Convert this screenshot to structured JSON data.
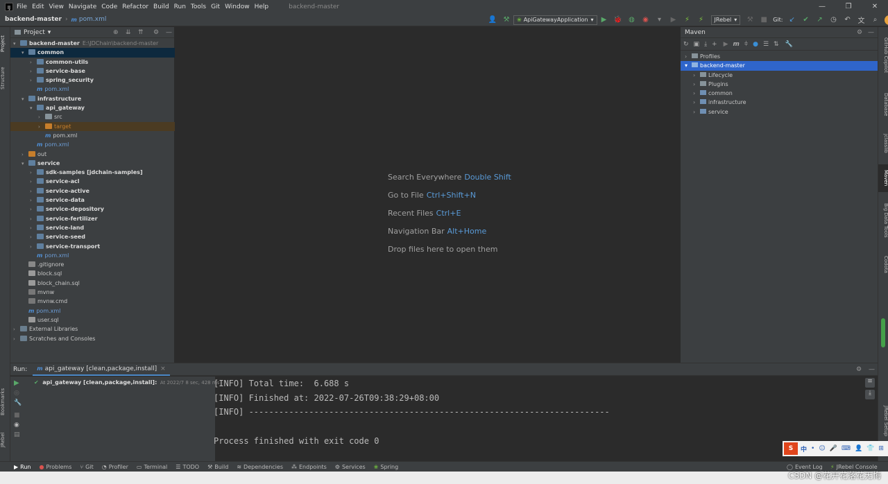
{
  "menubar": {
    "logo": "IJ",
    "items": [
      "File",
      "Edit",
      "View",
      "Navigate",
      "Code",
      "Refactor",
      "Build",
      "Run",
      "Tools",
      "Git",
      "Window",
      "Help"
    ],
    "window_title": "backend-master"
  },
  "navbar": {
    "project": "backend-master",
    "file": "pom.xml",
    "mvn_mark": "m"
  },
  "toolbar": {
    "run_config": "ApiGatewayApplication",
    "jrebel": "JRebel",
    "git_label": "Git:"
  },
  "project_panel": {
    "title": "Project",
    "rows": [
      {
        "text": "backend-master",
        "extra": "E:\\JDChain\\backend-master",
        "bold": true
      },
      {
        "text": "common",
        "bold": true
      },
      {
        "text": "common-utils",
        "bold": true
      },
      {
        "text": "service-base",
        "bold": true
      },
      {
        "text": "spring_security",
        "bold": true
      },
      {
        "text": "pom.xml"
      },
      {
        "text": "infrastructure",
        "bold": true
      },
      {
        "text": "api_gateway",
        "bold": true
      },
      {
        "text": "src"
      },
      {
        "text": "target"
      },
      {
        "text": "pom.xml"
      },
      {
        "text": "pom.xml"
      },
      {
        "text": "out"
      },
      {
        "text": "service",
        "bold": true
      },
      {
        "text": "sdk-samples [jdchain-samples]",
        "bold": true
      },
      {
        "text": "service-acl",
        "bold": true
      },
      {
        "text": "service-active",
        "bold": true
      },
      {
        "text": "service-data",
        "bold": true
      },
      {
        "text": "service-depository",
        "bold": true
      },
      {
        "text": "service-fertilizer",
        "bold": true
      },
      {
        "text": "service-land",
        "bold": true
      },
      {
        "text": "service-seed",
        "bold": true
      },
      {
        "text": "service-transport",
        "bold": true
      },
      {
        "text": "pom.xml"
      },
      {
        "text": ".gitignore"
      },
      {
        "text": "block.sql"
      },
      {
        "text": "block_chain.sql"
      },
      {
        "text": "mvnw"
      },
      {
        "text": "mvnw.cmd"
      },
      {
        "text": "pom.xml"
      },
      {
        "text": "user.sql"
      },
      {
        "text": "External Libraries"
      },
      {
        "text": "Scratches and Consoles"
      }
    ]
  },
  "editor_hints": [
    {
      "label": "Search Everywhere",
      "key": "Double Shift"
    },
    {
      "label": "Go to File",
      "key": "Ctrl+Shift+N"
    },
    {
      "label": "Recent Files",
      "key": "Ctrl+E"
    },
    {
      "label": "Navigation Bar",
      "key": "Alt+Home"
    },
    {
      "label": "Drop files here to open them",
      "key": ""
    }
  ],
  "maven_panel": {
    "title": "Maven",
    "rows": [
      "Profiles",
      "backend-master",
      "Lifecycle",
      "Plugins",
      "common",
      "infrastructure",
      "service"
    ]
  },
  "run_panel": {
    "label": "Run:",
    "tab": "api_gateway [clean,package,install]",
    "tree_item": "api_gateway [clean,package,install]:",
    "tree_time": "At 2022/7 8 sec, 428 ms",
    "console": [
      "[INFO] Total time:  6.688 s",
      "[INFO] Finished at: 2022-07-26T09:38:29+08:00",
      "[INFO] ------------------------------------------------------------------------",
      "",
      "Process finished with exit code 0"
    ]
  },
  "left_strip": [
    "Project",
    "Structure",
    "Bookmarks",
    "JRebel"
  ],
  "right_strip": [
    "GitHub Copilot",
    "Database",
    "jclasslib",
    "Maven",
    "Big Data Tools",
    "Codota",
    "JRebel Setup"
  ],
  "statusbar": {
    "items": [
      "Run",
      "Problems",
      "Git",
      "Profiler",
      "Terminal",
      "TODO",
      "Build",
      "Dependencies",
      "Endpoints",
      "Services",
      "Spring"
    ],
    "right": [
      "Event Log",
      "JRebel Console"
    ]
  },
  "watermark": "CSDN @花开花落花无悔",
  "ime": {
    "label": "中"
  }
}
